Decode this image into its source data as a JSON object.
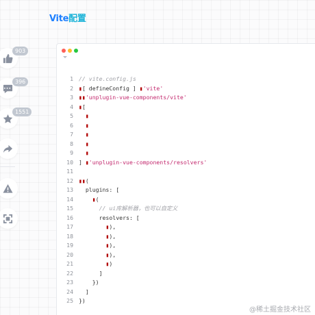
{
  "sidebar": {
    "actions": [
      {
        "name": "like",
        "icon": "thumbs-up-icon",
        "count": "903"
      },
      {
        "name": "comment",
        "icon": "comment-icon",
        "count": "396"
      },
      {
        "name": "collect",
        "icon": "star-icon",
        "count": "1551"
      },
      {
        "name": "share",
        "icon": "share-icon",
        "count": ""
      },
      {
        "name": "report",
        "icon": "warning-icon",
        "count": ""
      },
      {
        "name": "focus-mode",
        "icon": "scan-icon",
        "count": ""
      }
    ]
  },
  "article": {
    "heading_prefix": "Vite",
    "heading_suffix": "配置"
  },
  "code_block": {
    "lines": [
      {
        "n": "1",
        "tokens": [
          {
            "t": "// vite.config.js",
            "c": "cm"
          }
        ]
      },
      {
        "n": "2",
        "tokens": [
          {
            "t": "▮",
            "c": "mk"
          },
          {
            "t": "[ defineConfig ] "
          },
          {
            "t": "▮",
            "c": "mk"
          },
          {
            "t": "'vite'",
            "c": "str"
          }
        ]
      },
      {
        "n": "3",
        "tokens": [
          {
            "t": "▮▮",
            "c": "mk"
          },
          {
            "t": "'unplugin-vue-components/vite'",
            "c": "str"
          }
        ]
      },
      {
        "n": "4",
        "tokens": [
          {
            "t": "▮",
            "c": "mk"
          },
          {
            "t": "["
          }
        ]
      },
      {
        "n": "5",
        "tokens": [
          {
            "t": "  "
          },
          {
            "t": "▮",
            "c": "mk"
          }
        ]
      },
      {
        "n": "6",
        "tokens": [
          {
            "t": "  "
          },
          {
            "t": "▮",
            "c": "mk"
          }
        ]
      },
      {
        "n": "7",
        "tokens": [
          {
            "t": "  "
          },
          {
            "t": "▮",
            "c": "mk"
          }
        ]
      },
      {
        "n": "8",
        "tokens": [
          {
            "t": "  "
          },
          {
            "t": "▮",
            "c": "mk"
          }
        ]
      },
      {
        "n": "9",
        "tokens": [
          {
            "t": "  "
          },
          {
            "t": "▮",
            "c": "mk"
          }
        ]
      },
      {
        "n": "10",
        "tokens": [
          {
            "t": "] "
          },
          {
            "t": "▮",
            "c": "mk"
          },
          {
            "t": "'unplugin-vue-components/resolvers'",
            "c": "str"
          }
        ]
      },
      {
        "n": "11",
        "tokens": []
      },
      {
        "n": "12",
        "tokens": [
          {
            "t": "▮▮",
            "c": "mk"
          },
          {
            "t": "("
          }
        ]
      },
      {
        "n": "13",
        "tokens": [
          {
            "t": "  plugins: ["
          }
        ]
      },
      {
        "n": "14",
        "tokens": [
          {
            "t": "    "
          },
          {
            "t": "▮",
            "c": "mk"
          },
          {
            "t": "("
          }
        ]
      },
      {
        "n": "15",
        "tokens": [
          {
            "t": "      "
          },
          {
            "t": "// ui库解析器，也可以自定义",
            "c": "cm"
          }
        ]
      },
      {
        "n": "16",
        "tokens": [
          {
            "t": "      resolvers: ["
          }
        ]
      },
      {
        "n": "17",
        "tokens": [
          {
            "t": "        "
          },
          {
            "t": "▮",
            "c": "mk"
          },
          {
            "t": "),"
          }
        ]
      },
      {
        "n": "18",
        "tokens": [
          {
            "t": "        "
          },
          {
            "t": "▮",
            "c": "mk"
          },
          {
            "t": "),"
          }
        ]
      },
      {
        "n": "19",
        "tokens": [
          {
            "t": "        "
          },
          {
            "t": "▮",
            "c": "mk"
          },
          {
            "t": "),"
          }
        ]
      },
      {
        "n": "20",
        "tokens": [
          {
            "t": "        "
          },
          {
            "t": "▮",
            "c": "mk"
          },
          {
            "t": "),"
          }
        ]
      },
      {
        "n": "21",
        "tokens": [
          {
            "t": "        "
          },
          {
            "t": "▮",
            "c": "mk"
          },
          {
            "t": ")"
          }
        ]
      },
      {
        "n": "22",
        "tokens": [
          {
            "t": "      ]"
          }
        ]
      },
      {
        "n": "23",
        "tokens": [
          {
            "t": "    })"
          }
        ]
      },
      {
        "n": "24",
        "tokens": [
          {
            "t": "  ]"
          }
        ]
      },
      {
        "n": "25",
        "tokens": [
          {
            "t": "})"
          }
        ]
      }
    ]
  },
  "watermark": "@稀土掘金技术社区",
  "colors": {
    "accent": "#1e80ff",
    "heading_suffix": "#1fb4d8",
    "string": "#c3296e",
    "comment": "#a0a1a7",
    "marker": "#b10000"
  }
}
